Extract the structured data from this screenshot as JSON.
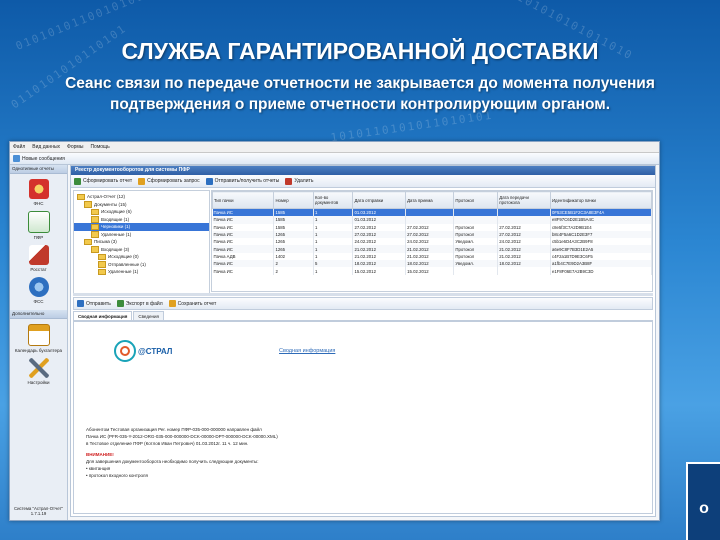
{
  "slide": {
    "title": "СЛУЖБА ГАРАНТИРОВАННОЙ ДОСТАВКИ",
    "subtitle_line1": "Сеанс связи по передаче отчетности не закрывается до момента получения",
    "subtitle_line2": "подтверждения о приеме отчетности контролирующим органом.",
    "corner_letter": "о",
    "binary": [
      "01010101100101010110",
      "10101101010101011010",
      "0110101010110101",
      "1010110101011010101"
    ]
  },
  "app": {
    "menu": [
      "Файл",
      "Вид данных",
      "Формы",
      "Помощь"
    ],
    "toolbar": [
      "Новые сообщения"
    ],
    "sidebar": {
      "header": "Однотипные отчеты",
      "items": [
        {
          "label": "ФНС",
          "icon": "fns-icon",
          "color": "#d4322c"
        },
        {
          "label": "ПФР",
          "icon": "pfr-icon",
          "color": "#3b8c3a"
        },
        {
          "label": "Росстат",
          "icon": "rosstat-icon",
          "color": "#c0392b"
        },
        {
          "label": "ФСС",
          "icon": "fss-icon",
          "color": "#2d6fc0"
        }
      ],
      "header2": "Дополнительно",
      "items2": [
        {
          "label": "Календарь бухгалтера",
          "icon": "calendar-icon",
          "color": "#e0a020"
        },
        {
          "label": "Настройки",
          "icon": "tools-icon",
          "color": "#5a6b80"
        }
      ],
      "footer_label": "Система \"Астрал-Отчет\"",
      "version": "1.7.1.19"
    },
    "main_title": "Реестр документооборотов для системы ПФР",
    "toolbar2": [
      "Сформировать отчет",
      "Сформировать запрос",
      "Отправить/получить отчеты",
      "Удалить"
    ],
    "tree": [
      {
        "label": "Астрал-Отчет (12)",
        "indent": 0
      },
      {
        "label": "Документы (15)",
        "indent": 1
      },
      {
        "label": "Исходящие (6)",
        "indent": 2
      },
      {
        "label": "Входящие (1)",
        "indent": 2
      },
      {
        "label": "Черновики (1)",
        "indent": 2,
        "selected": true
      },
      {
        "label": "Удаленные (1)",
        "indent": 2
      },
      {
        "label": "Письма (3)",
        "indent": 1
      },
      {
        "label": "Входящие (3)",
        "indent": 2
      },
      {
        "label": "Исходящие (0)",
        "indent": 3
      },
      {
        "label": "Отправленные (1)",
        "indent": 3
      },
      {
        "label": "Удаленные (1)",
        "indent": 3
      }
    ],
    "grid": {
      "columns": [
        "Тип пачки",
        "Номер",
        "Кол-во документов",
        "Дата отправки",
        "Дата приема",
        "Протокол",
        "Дата передачи протокола",
        "Идентификатор пачки"
      ],
      "rows": [
        {
          "cells": [
            "Пачка ИС",
            "1585",
            "1",
            "01.03.2012",
            "",
            "",
            "",
            "0F53CE5B1F2C3A8E3F4A"
          ],
          "selected": true
        },
        {
          "cells": [
            "Пачка ИС",
            "1585",
            "1",
            "01.03.2012",
            "",
            "",
            "",
            "e8F97C6D2E1B5A4C"
          ]
        },
        {
          "cells": [
            "Пачка ИС",
            "1585",
            "1",
            "27.02.2012",
            "27.02.2012",
            "Протокол",
            "27.02.2012",
            "c8e5f3C7A2D9B1E4"
          ]
        },
        {
          "cells": [
            "Пачка ИС",
            "1265",
            "1",
            "27.02.2012",
            "27.02.2012",
            "Протокол",
            "27.02.2012",
            "b8c4F5a6C1D2E3F7"
          ]
        },
        {
          "cells": [
            "Пачка ИС",
            "1265",
            "1",
            "24.02.2012",
            "24.02.2012",
            "Уведомл.",
            "24.02.2012",
            "c5b1e6D4A3C2B9F8"
          ]
        },
        {
          "cells": [
            "Пачка ИС",
            "1265",
            "1",
            "21.02.2012",
            "21.02.2012",
            "Протокол",
            "21.02.2012",
            "a6e9C8F7B3D1E2A5"
          ]
        },
        {
          "cells": [
            "Пачка АДВ",
            "1402",
            "1",
            "21.02.2012",
            "21.02.2012",
            "Протокол",
            "21.02.2012",
            "c4F2a1B7D9E3C6F5"
          ]
        },
        {
          "cells": [
            "Пачка ИС",
            "2",
            "5",
            "18.02.2012",
            "18.02.2012",
            "Уведомл.",
            "18.02.2012",
            "a1fb4C7E9D2A3B8F"
          ]
        },
        {
          "cells": [
            "Пачка ИС",
            "2",
            "1",
            "15.02.2012",
            "15.02.2012",
            "",
            "",
            "e1F8F06E7A2B9C3D"
          ]
        }
      ]
    },
    "toolbar3": [
      "Отправить",
      "Экспорт в файл",
      "Сохранить отчет"
    ],
    "tabs": [
      "Сводная информация",
      "Сведения"
    ],
    "doc": {
      "logo": "@СТРАЛ",
      "heading": "Сводная информация",
      "line1": "Абонентом Тестовая организация Рег. номер ПФР-035-000-000000 направлен файл",
      "line2": "Пачка ИС (PFR-035-Y-2012-ORG-035-000-000000-DCK-00000-DPT-000000-DCK-00000.XML)",
      "line3": "в Тестовое отделение ПФР (Котлов Иван Петрович) 01.03.2012г. 11 ч. 12 мин.",
      "notice_label": "ВНИМАНИЕ!",
      "line4": "Для завершения документооборота необходимо получить следующие документы:",
      "bullet1": "квитанция",
      "bullet2": "протокол входного контроля"
    }
  }
}
